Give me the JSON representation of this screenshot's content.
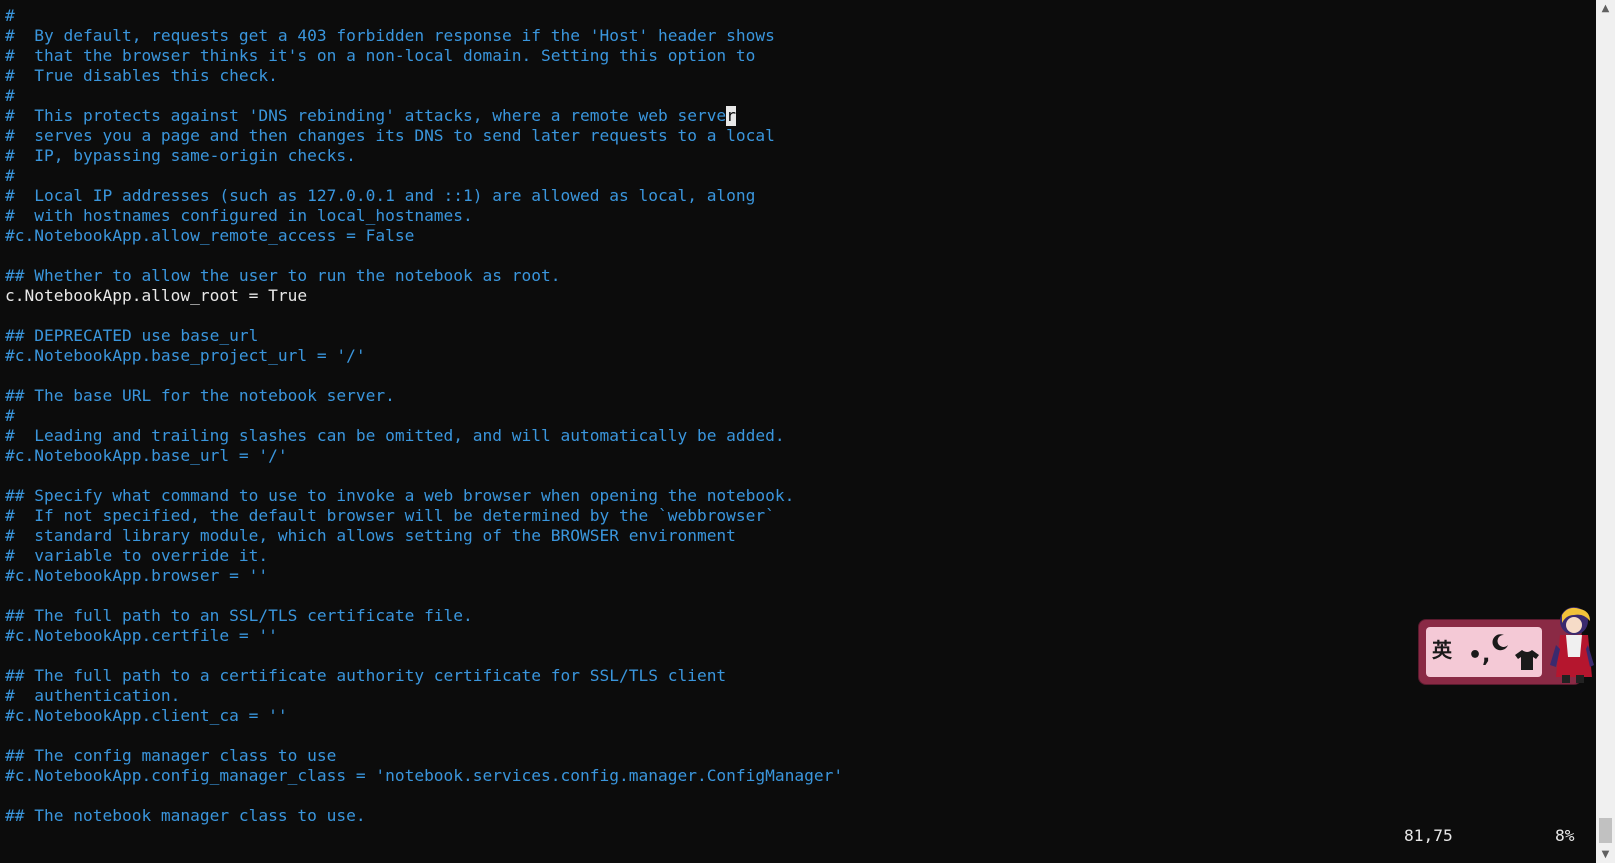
{
  "editor": {
    "cursor": {
      "line": 81,
      "column": 75
    },
    "lines": [
      {
        "type": "comment",
        "text": "#"
      },
      {
        "type": "comment",
        "text": "#  By default, requests get a 403 forbidden response if the 'Host' header shows"
      },
      {
        "type": "comment",
        "text": "#  that the browser thinks it's on a non-local domain. Setting this option to"
      },
      {
        "type": "comment",
        "text": "#  True disables this check."
      },
      {
        "type": "comment",
        "text": "#"
      },
      {
        "type": "comment_cursor",
        "before": "#  This protects against 'DNS rebinding' attacks, where a remote web serve",
        "cursor": "r",
        "after": ""
      },
      {
        "type": "comment",
        "text": "#  serves you a page and then changes its DNS to send later requests to a local"
      },
      {
        "type": "comment",
        "text": "#  IP, bypassing same-origin checks."
      },
      {
        "type": "comment",
        "text": "#"
      },
      {
        "type": "comment",
        "text": "#  Local IP addresses (such as 127.0.0.1 and ::1) are allowed as local, along"
      },
      {
        "type": "comment",
        "text": "#  with hostnames configured in local_hostnames."
      },
      {
        "type": "comment",
        "text": "#c.NotebookApp.allow_remote_access = False"
      },
      {
        "type": "blank",
        "text": ""
      },
      {
        "type": "comment",
        "text": "## Whether to allow the user to run the notebook as root."
      },
      {
        "type": "code",
        "text": "c.NotebookApp.allow_root = True"
      },
      {
        "type": "blank",
        "text": ""
      },
      {
        "type": "comment",
        "text": "## DEPRECATED use base_url"
      },
      {
        "type": "comment",
        "text": "#c.NotebookApp.base_project_url = '/'"
      },
      {
        "type": "blank",
        "text": ""
      },
      {
        "type": "comment",
        "text": "## The base URL for the notebook server."
      },
      {
        "type": "comment",
        "text": "#"
      },
      {
        "type": "comment",
        "text": "#  Leading and trailing slashes can be omitted, and will automatically be added."
      },
      {
        "type": "comment",
        "text": "#c.NotebookApp.base_url = '/'"
      },
      {
        "type": "blank",
        "text": ""
      },
      {
        "type": "comment",
        "text": "## Specify what command to use to invoke a web browser when opening the notebook."
      },
      {
        "type": "comment",
        "text": "#  If not specified, the default browser will be determined by the `webbrowser`"
      },
      {
        "type": "comment",
        "text": "#  standard library module, which allows setting of the BROWSER environment"
      },
      {
        "type": "comment",
        "text": "#  variable to override it."
      },
      {
        "type": "comment",
        "text": "#c.NotebookApp.browser = ''"
      },
      {
        "type": "blank",
        "text": ""
      },
      {
        "type": "comment",
        "text": "## The full path to an SSL/TLS certificate file."
      },
      {
        "type": "comment",
        "text": "#c.NotebookApp.certfile = ''"
      },
      {
        "type": "blank",
        "text": ""
      },
      {
        "type": "comment",
        "text": "## The full path to a certificate authority certificate for SSL/TLS client"
      },
      {
        "type": "comment",
        "text": "#  authentication."
      },
      {
        "type": "comment",
        "text": "#c.NotebookApp.client_ca = ''"
      },
      {
        "type": "blank",
        "text": ""
      },
      {
        "type": "comment",
        "text": "## The config manager class to use"
      },
      {
        "type": "comment",
        "text": "#c.NotebookApp.config_manager_class = 'notebook.services.config.manager.ConfigManager'"
      },
      {
        "type": "blank",
        "text": ""
      },
      {
        "type": "comment",
        "text": "## The notebook manager class to use."
      }
    ]
  },
  "status": {
    "position": "81,75",
    "percent": "8%"
  },
  "scrollbar": {
    "up_arrow": "▲",
    "down_arrow": "▼",
    "scroll_fraction": 0.08
  },
  "ime": {
    "language": "英",
    "punctuation": "•,",
    "moon_icon": "moon-icon",
    "shirt_icon": "shirt-icon",
    "avatar_icon": "anime-avatar-icon"
  },
  "colors": {
    "background": "#0c0c0c",
    "comment": "#3a96dd",
    "code": "#e8e8e8",
    "cursor_bg": "#e8e8e8"
  }
}
